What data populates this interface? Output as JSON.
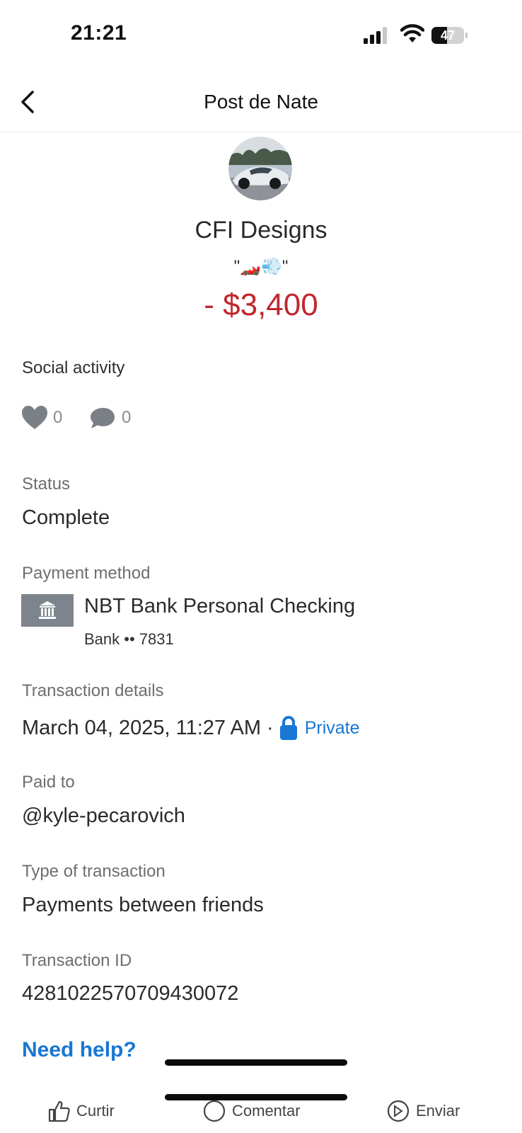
{
  "status_bar": {
    "time": "21:21",
    "battery_level": "47",
    "icons": [
      "cellular-signal-icon",
      "wifi-icon",
      "battery-icon"
    ]
  },
  "nav": {
    "back_icon": "chevron-left-icon",
    "title": "Post de Nate"
  },
  "header": {
    "merchant": "CFI Designs",
    "note": "\"🏎️💨\"",
    "amount": "- $3,400",
    "amount_color": "#c1272d"
  },
  "social": {
    "label": "Social activity",
    "likes": "0",
    "comments": "0"
  },
  "status": {
    "label": "Status",
    "value": "Complete"
  },
  "payment_method": {
    "label": "Payment method",
    "icon": "bank-icon",
    "name": "NBT Bank Personal Checking",
    "account": "Bank •• 7831"
  },
  "transaction_details": {
    "label": "Transaction details",
    "datetime": "March 04, 2025, 11:27 AM",
    "separator": "·",
    "privacy": "Private",
    "privacy_color": "#1877d3"
  },
  "paid_to": {
    "label": "Paid to",
    "value": "@kyle-pecarovich"
  },
  "type": {
    "label": "Type of transaction",
    "value": "Payments between friends"
  },
  "transaction_id": {
    "label": "Transaction ID",
    "value": "4281022570709430072"
  },
  "help": {
    "label": "Need help?"
  },
  "bottom_actions": {
    "like": "Curtir",
    "comment": "Comentar",
    "send": "Enviar"
  }
}
